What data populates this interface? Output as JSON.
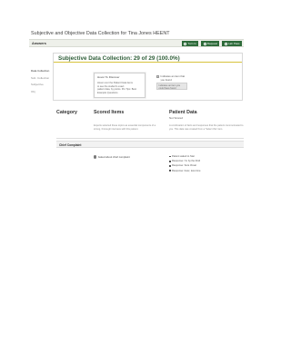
{
  "page": {
    "title": "Subjective and Objective Data Collection for Tina Jones HEENT"
  },
  "toolbar": {
    "label": "Answers",
    "buttons": [
      {
        "label": "Turn In",
        "icon": "send-icon"
      },
      {
        "label": "Request",
        "icon": "request-icon"
      },
      {
        "label": "Lab Pass",
        "icon": "pass-icon"
      }
    ]
  },
  "sidebar": {
    "items": [
      "Data Collection",
      "Sub. Collection",
      "Subjective",
      "Obj"
    ]
  },
  "panel": {
    "title": "Subjective Data Collection: 29 of 29 (100.0%)",
    "info_box": {
      "title": "Hover To Discover",
      "lines": [
        "Hover over the Patient Data items",
        "to see the student's exact",
        "patient data, by points. Pro Tips: Best",
        "Example Questions"
      ]
    },
    "legend": {
      "item": "Indicates an item that you found",
      "button_text": "Indicates an item you could have found"
    }
  },
  "columns": {
    "category": "Category",
    "scored_items": "Scored Items",
    "scored_items_desc": "Experts selected these topics as essential components of a strong, thorough interview with this patient.",
    "patient_data": "Patient Data",
    "patient_data_sub": "Not Scored",
    "patient_data_desc": "A combination of facts and responses that the patient communicated to you. This data was created from a 'Select this' item."
  },
  "sections": [
    {
      "name": "Chief Complaint",
      "scored_item": "Asked about chief complaint",
      "answers": [
        "Patient asked to Stat",
        "Response: I'm by the third",
        "Response: Sore throat",
        "Response: fever, less time"
      ]
    }
  ],
  "colors": {
    "accent_green": "#2e6b3a",
    "title_green": "#2f5e39",
    "underline_gold": "#d7c33c"
  }
}
